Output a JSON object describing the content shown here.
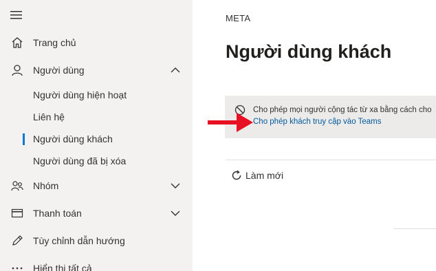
{
  "sidebar": {
    "menu_icon": "hamburger-icon",
    "items": [
      {
        "label": "Trang chủ",
        "icon": "home-icon"
      },
      {
        "label": "Người dùng",
        "icon": "person-icon",
        "expanded": true
      },
      {
        "label": "Nhóm",
        "icon": "group-icon"
      },
      {
        "label": "Thanh toán",
        "icon": "credit-card-icon"
      },
      {
        "label": "Tùy chỉnh dẫn hướng",
        "icon": "pencil-icon"
      },
      {
        "label": "Hiển thị tất cả",
        "icon": "ellipsis-icon"
      }
    ],
    "subitems": [
      {
        "label": "Người dùng hiện hoạt"
      },
      {
        "label": "Liên hệ"
      },
      {
        "label": "Người dùng khách",
        "selected": true
      },
      {
        "label": "Người dùng đã bị xóa"
      }
    ]
  },
  "main": {
    "org": "META",
    "title": "Người dùng khách",
    "banner": {
      "text": "Cho phép mọi người cộng tác từ xa bằng cách cho",
      "link": "Cho phép khách truy cập vào Teams"
    },
    "refresh_label": "Làm mới"
  },
  "colors": {
    "sidebar_bg": "#f3f2f1",
    "accent": "#0078d4",
    "link": "#005a9e",
    "banner_bg": "#edebe9",
    "annotation_arrow": "#e81123"
  }
}
